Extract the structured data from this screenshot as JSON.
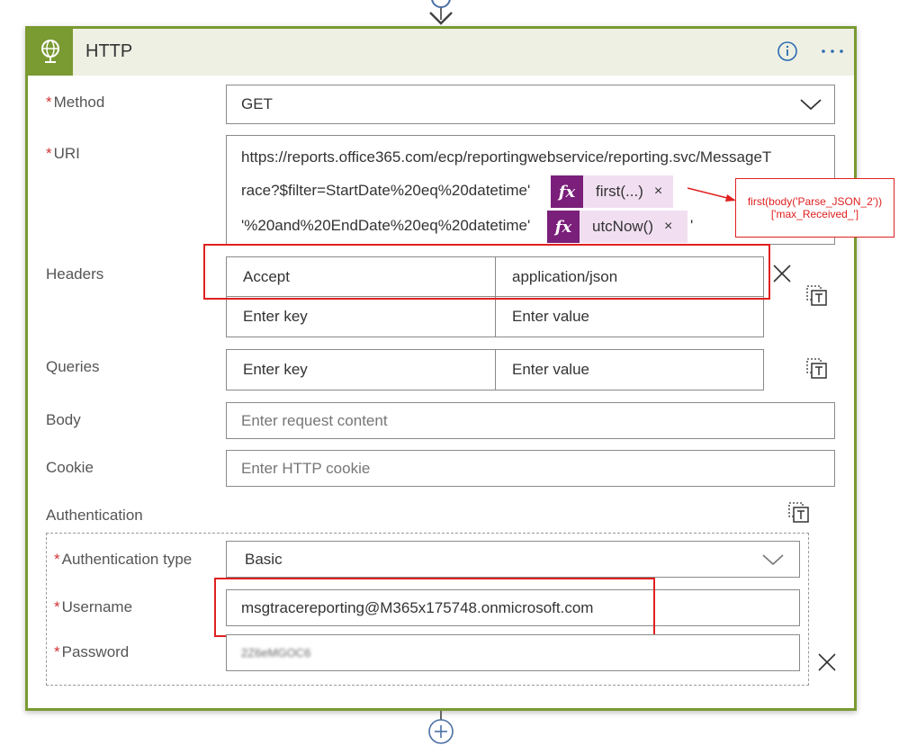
{
  "action": {
    "title": "HTTP",
    "icon": "globe-icon",
    "info_icon": "info-icon",
    "menu_icon": "ellipsis-icon"
  },
  "method": {
    "label": "Method",
    "required_mark": "*",
    "value": "GET"
  },
  "uri": {
    "label": "URI",
    "required_mark": "*",
    "line1": "https://reports.office365.com/ecp/reportingwebservice/reporting.svc/MessageT",
    "line2": "race?$filter=StartDate%20eq%20datetime'",
    "line3": "'%20and%20EndDate%20eq%20datetime'",
    "trailing_quote": "'",
    "token1": {
      "fx": "fx",
      "text": "first(...)",
      "close": "×"
    },
    "token2": {
      "fx": "fx",
      "text": "utcNow()",
      "close": "×"
    }
  },
  "annotation": {
    "line1": "first(body('Parse_JSON_2'))",
    "line2": "['max_Received_']"
  },
  "headers": {
    "label": "Headers",
    "rows": [
      {
        "key": "Accept",
        "value": "application/json"
      }
    ],
    "key_placeholder": "Enter key",
    "value_placeholder": "Enter value",
    "delete_icon": "×"
  },
  "queries": {
    "label": "Queries",
    "key_placeholder": "Enter key",
    "value_placeholder": "Enter value"
  },
  "body": {
    "label": "Body",
    "placeholder": "Enter request content"
  },
  "cookie": {
    "label": "Cookie",
    "placeholder": "Enter HTTP cookie"
  },
  "authentication": {
    "label": "Authentication",
    "type_label": "Authentication type",
    "type_value": "Basic",
    "username_label": "Username",
    "username_value": "msgtracereporting@M365x175748.onmicrosoft.com",
    "password_label": "Password",
    "password_value": "2Z6eMGOC6",
    "required_mark": "*",
    "delete_icon": "×"
  },
  "colors": {
    "accent": "#7a9a32",
    "header_bg": "#eef0e3",
    "expression_token": "#7a1f7a",
    "token_bg": "#f1dff1",
    "required": "#d13438",
    "highlight": "#e02020"
  }
}
